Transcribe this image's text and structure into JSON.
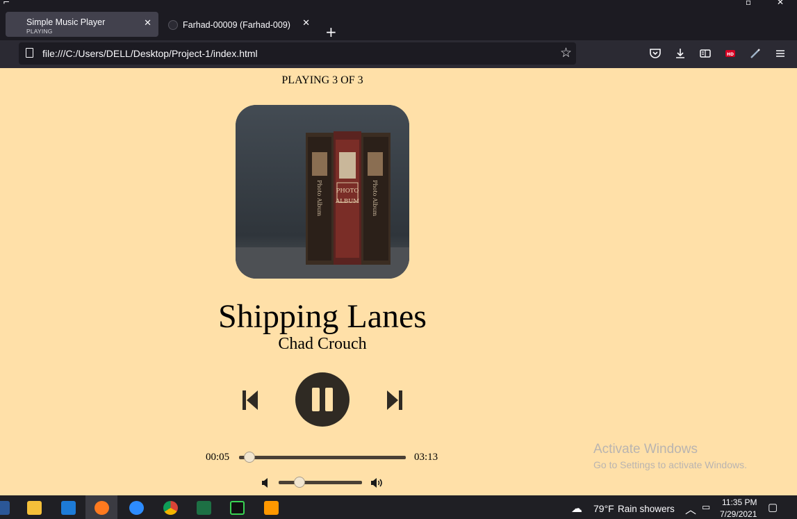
{
  "browser": {
    "tabs": [
      {
        "title": "Simple Music Player",
        "subtitle": "PLAYING"
      },
      {
        "title": "Farhad-00009 (Farhad-009)"
      }
    ],
    "url": "file:///C:/Users/DELL/Desktop/Project-1/index.html",
    "toolbar_icons": [
      "pocket-icon",
      "download-icon",
      "reader-view-icon",
      "hd-extension-icon",
      "pen-extension-icon",
      "menu-icon"
    ]
  },
  "player": {
    "status_text": "PLAYING 3 OF 3",
    "song_title": "Shipping Lanes",
    "artist": "Chad Crouch",
    "current_time": "00:05",
    "total_time": "03:13",
    "seek_progress": 0.03,
    "volume_level": 0.25,
    "cover_art": {
      "album_spine_label": "PHOTO",
      "album_spine_label2": "ALBUM",
      "side_spine_label": "Photo Album"
    }
  },
  "watermark": {
    "line1": "Activate Windows",
    "line2": "Go to Settings to activate Windows."
  },
  "taskbar": {
    "weather_temp": "79°F",
    "weather_desc": "Rain showers",
    "time": "11:35 PM",
    "date": "7/29/2021"
  },
  "colors": {
    "page_background": "#ffe0a8",
    "player_dark": "#2f2a23",
    "chrome_dark": "#1c1b22"
  }
}
